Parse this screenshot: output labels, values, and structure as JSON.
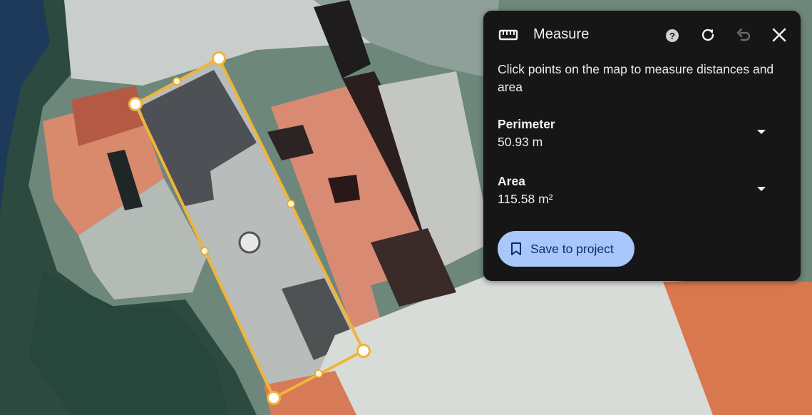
{
  "panel": {
    "title": "Measure",
    "description": "Click points on the map to measure distances and area",
    "perimeter_label": "Perimeter",
    "perimeter_value": "50.93 m",
    "area_label": "Area",
    "area_value": "115.58 m²",
    "save_label": "Save to project"
  },
  "icons": [
    "ruler-icon",
    "help-icon",
    "refresh-icon",
    "undo-icon",
    "close-icon",
    "chevron-down-icon",
    "bookmark-icon"
  ],
  "colors": {
    "panel_bg": "#161616",
    "accent_button": "#a8c7fa",
    "measure_line": "#f0b43a"
  }
}
